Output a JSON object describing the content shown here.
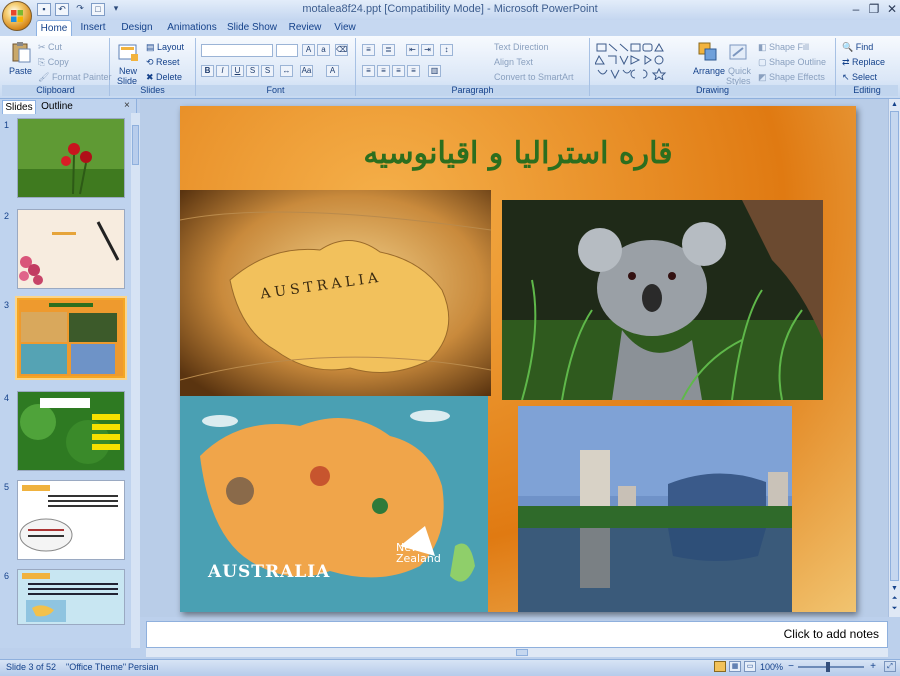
{
  "window": {
    "title": "motalea8f24.ppt [Compatibility Mode] - Microsoft PowerPoint"
  },
  "tabs": [
    "Home",
    "Insert",
    "Design",
    "Animations",
    "Slide Show",
    "Review",
    "View"
  ],
  "ribbon": {
    "clipboard": {
      "paste": "Paste",
      "cut": "Cut",
      "copy": "Copy",
      "format_painter": "Format Painter",
      "label": "Clipboard"
    },
    "slides": {
      "new_slide": "New",
      "new_slide2": "Slide",
      "layout": "Layout",
      "reset": "Reset",
      "delete": "Delete",
      "label": "Slides"
    },
    "font": {
      "label": "Font"
    },
    "paragraph": {
      "text_direction": "Text Direction",
      "align_text": "Align Text",
      "convert_smartart": "Convert to SmartArt",
      "label": "Paragraph"
    },
    "drawing": {
      "arrange": "Arrange",
      "quick_styles": "Quick",
      "quick_styles2": "Styles",
      "shape_fill": "Shape Fill",
      "shape_outline": "Shape Outline",
      "shape_effects": "Shape Effects",
      "label": "Drawing"
    },
    "editing": {
      "find": "Find",
      "replace": "Replace",
      "select": "Select",
      "label": "Editing"
    }
  },
  "panel": {
    "tab_slides": "Slides",
    "tab_outline": "Outline",
    "thumb_numbers": [
      "1",
      "2",
      "3",
      "4",
      "5",
      "6"
    ]
  },
  "slide": {
    "title": "قاره استراليا و اقيانوسيه",
    "map_label": "AUSTRALIA",
    "map_label2": "AUSTRALIA",
    "nz_label": "New Zealand"
  },
  "notes": {
    "placeholder": "Click to add notes"
  },
  "status": {
    "slide_of": "Slide 3 of 52",
    "theme": "\"Office Theme\"",
    "language": "Persian",
    "zoom": "100%"
  }
}
